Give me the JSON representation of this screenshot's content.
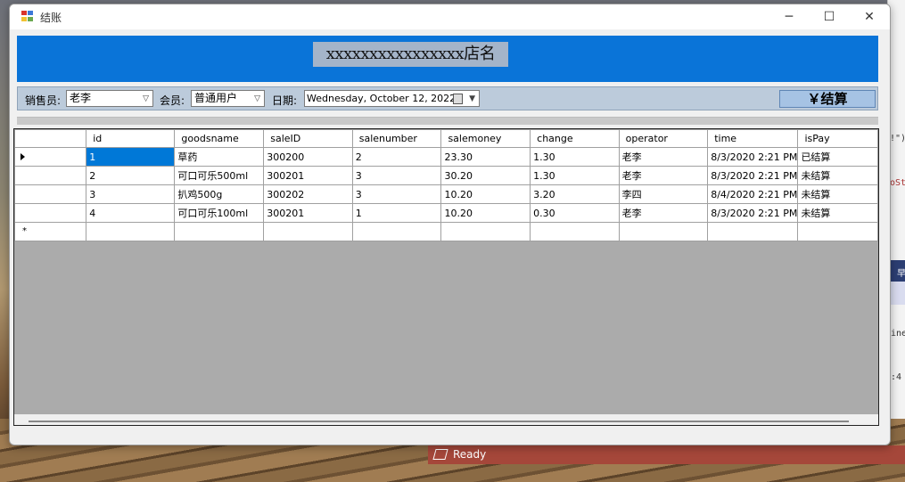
{
  "window": {
    "title": "结账",
    "controls": {
      "minimize": "─",
      "maximize": "☐",
      "close": "✕"
    }
  },
  "banner": {
    "store_name": "xxxxxxxxxxxxxxxx店名",
    "color": "#0a74d8"
  },
  "toolbar": {
    "salesperson_label": "销售员:",
    "salesperson_value": "老李",
    "member_label": "会员:",
    "member_value": "普通用户",
    "date_label": "日期:",
    "date_value": "Wednesday,   October   12, 2022",
    "checkout_label": "￥结算"
  },
  "grid": {
    "columns": [
      "id",
      "goodsname",
      "saleID",
      "salenumber",
      "salemoney",
      "change",
      "operator",
      "time",
      "isPay"
    ],
    "rows": [
      [
        "1",
        "草药",
        "300200",
        "2",
        "23.30",
        "1.30",
        "老李",
        "8/3/2020 2:21 PM",
        "已结算"
      ],
      [
        "2",
        "可口可乐500ml",
        "300201",
        "3",
        "30.20",
        "1.30",
        "老李",
        "8/3/2020 2:21 PM",
        "未结算"
      ],
      [
        "3",
        "扒鸡500g",
        "300202",
        "3",
        "10.20",
        "3.20",
        "李四",
        "8/4/2020 2:21 PM",
        "未结算"
      ],
      [
        "4",
        "可口可乐100ml",
        "300201",
        "1",
        "10.20",
        "0.30",
        "老李",
        "8/3/2020 2:21 PM",
        "未结算"
      ]
    ],
    "new_row_marker": "*",
    "selected_color": "#0078d7"
  },
  "background": {
    "status_text": "Ready",
    "code_fragments": [
      "!\")",
      "oSt",
      "早",
      "ine",
      ":4"
    ]
  }
}
